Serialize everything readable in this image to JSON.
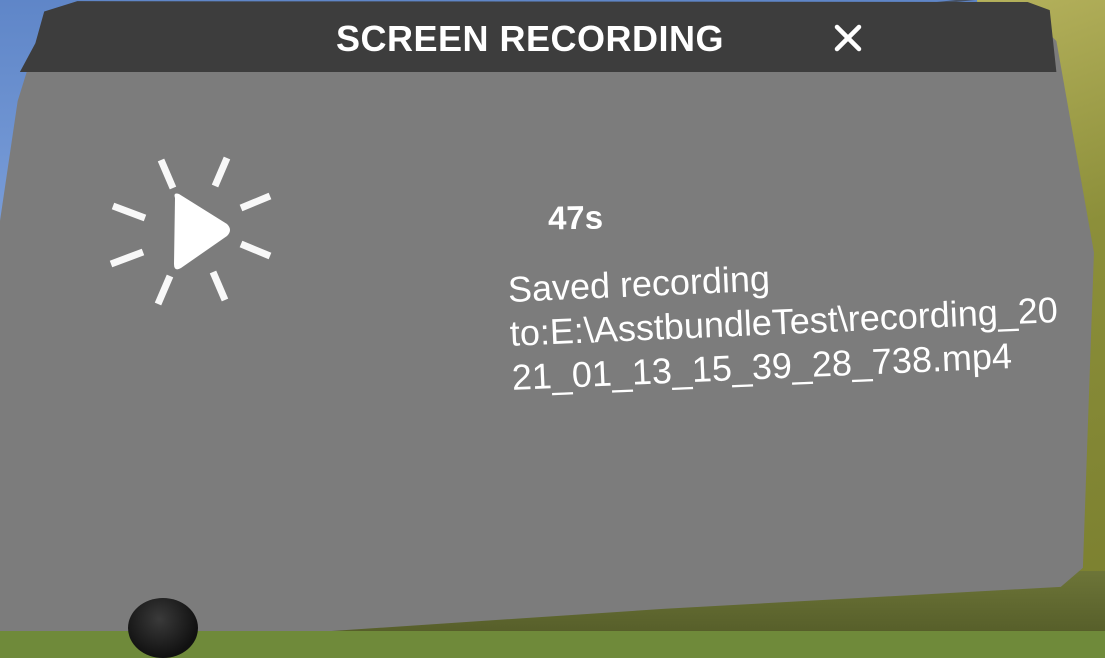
{
  "dialog": {
    "title": "SCREEN RECORDING",
    "close_icon": "close-icon",
    "record_icon": "play-burst-icon"
  },
  "status": {
    "elapsed": "47s",
    "message_lines": [
      "Saved recording",
      "to:E:\\AsstbundleTest\\recording_20",
      "21_01_13_15_39_28_738.mp4"
    ]
  },
  "colors": {
    "panel": "#7c7c7c",
    "titlebar": "#3d3d3d",
    "text": "#ffffff"
  }
}
